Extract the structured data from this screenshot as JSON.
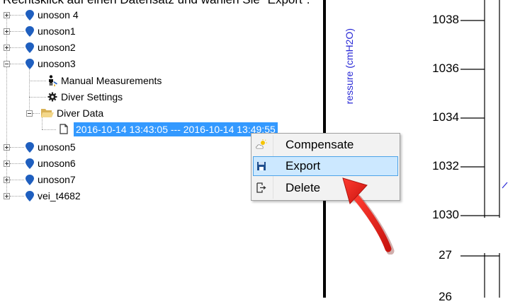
{
  "caption": "Rechtsklick auf einen Datensatz und wählen Sie \"Export\".",
  "tree": {
    "items": [
      {
        "label": "unoson 4",
        "type": "station",
        "expanded": false
      },
      {
        "label": "unoson1",
        "type": "station",
        "expanded": false
      },
      {
        "label": "unoson2",
        "type": "station",
        "expanded": false
      },
      {
        "label": "unoson3",
        "type": "station",
        "expanded": true
      },
      {
        "label": "Manual Measurements",
        "type": "manual"
      },
      {
        "label": "Diver Settings",
        "type": "settings"
      },
      {
        "label": "Diver Data",
        "type": "folder",
        "expanded": true
      },
      {
        "label": "unoson5",
        "type": "station",
        "expanded": false
      },
      {
        "label": "unoson6",
        "type": "station",
        "expanded": false
      },
      {
        "label": "unoson7",
        "type": "station",
        "expanded": false
      },
      {
        "label": "vei_t4682",
        "type": "station",
        "expanded": false
      }
    ],
    "selected_dataset": "2016-10-14 13:43:05  ---  2016-10-14 13:49:55"
  },
  "chart": {
    "ylabel": "ressure (cmH2O)",
    "upper_ticks": [
      "1038",
      "1036",
      "1034",
      "1032",
      "1030"
    ],
    "lower_ticks": [
      "27",
      "26"
    ]
  },
  "context_menu": {
    "items": [
      {
        "label": "Compensate",
        "icon": "weather-icon"
      },
      {
        "label": "Export",
        "icon": "save-icon",
        "hovered": true
      },
      {
        "label": "Delete",
        "icon": "delete-icon"
      }
    ]
  },
  "colors": {
    "selection": "#3399ff",
    "menu_hover": "#cce8ff",
    "pin": "#1f5fbf",
    "annotation_arrow": "#e0201b",
    "axis_label": "#2b2bd6"
  }
}
